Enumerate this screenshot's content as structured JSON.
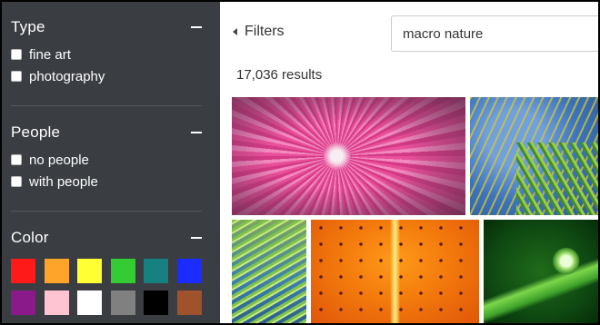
{
  "sidebar": {
    "type": {
      "title": "Type",
      "options": [
        {
          "label": "fine art",
          "checked": false
        },
        {
          "label": "photography",
          "checked": false
        }
      ]
    },
    "people": {
      "title": "People",
      "options": [
        {
          "label": "no people",
          "checked": false
        },
        {
          "label": "with people",
          "checked": false
        }
      ]
    },
    "color": {
      "title": "Color",
      "swatches": [
        {
          "name": "red",
          "hex": "#ff1a1a"
        },
        {
          "name": "orange",
          "hex": "#ffa42a"
        },
        {
          "name": "yellow",
          "hex": "#ffff33"
        },
        {
          "name": "green",
          "hex": "#33cc33"
        },
        {
          "name": "teal",
          "hex": "#178080"
        },
        {
          "name": "blue",
          "hex": "#1a2cff"
        },
        {
          "name": "purple",
          "hex": "#8a1a8a"
        },
        {
          "name": "pink",
          "hex": "#ffc4d2"
        },
        {
          "name": "white",
          "hex": "#ffffff"
        },
        {
          "name": "gray",
          "hex": "#808080"
        },
        {
          "name": "black",
          "hex": "#000000"
        },
        {
          "name": "brown",
          "hex": "#a0522d"
        }
      ]
    },
    "collapse_icon": "minus-icon"
  },
  "main": {
    "filters_label": "Filters",
    "back_icon": "caret-left-icon",
    "search": {
      "value": "macro nature",
      "placeholder": ""
    },
    "results_text": "17,036 results"
  },
  "colors": {
    "sidebar_bg": "#3a3d42",
    "text_main": "#333333"
  }
}
